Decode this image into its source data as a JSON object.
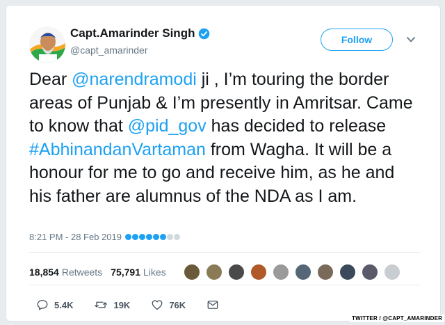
{
  "tweet": {
    "display_name": "Capt.Amarinder Singh",
    "handle": "@capt_amarinder",
    "follow_label": "Follow",
    "text_parts": {
      "p1": "Dear ",
      "mention1": "@narendramodi",
      "p2": " ji , I’m touring the border areas of Punjab & I’m presently in Amritsar. Came to know that ",
      "mention2": "@pid_gov",
      "p3": " has decided to release ",
      "hashtag": "#AbhinandanVartaman",
      "p4": " from Wagha. It will be a honour for me to go and receive him, as he and his father are alumnus of the NDA as I am."
    },
    "timestamp": "8:21 PM - 28 Feb 2019",
    "retweets_count": "18,854",
    "retweets_label": "Retweets",
    "likes_count": "75,791",
    "likes_label": "Likes",
    "actions": {
      "replies": "5.4K",
      "retweets": "19K",
      "likes": "76K"
    }
  },
  "colors": {
    "link": "#1da1f2",
    "text": "#14171a",
    "muted": "#657786"
  },
  "watermark": "TWITTER / @CAPT_AMARINDER"
}
